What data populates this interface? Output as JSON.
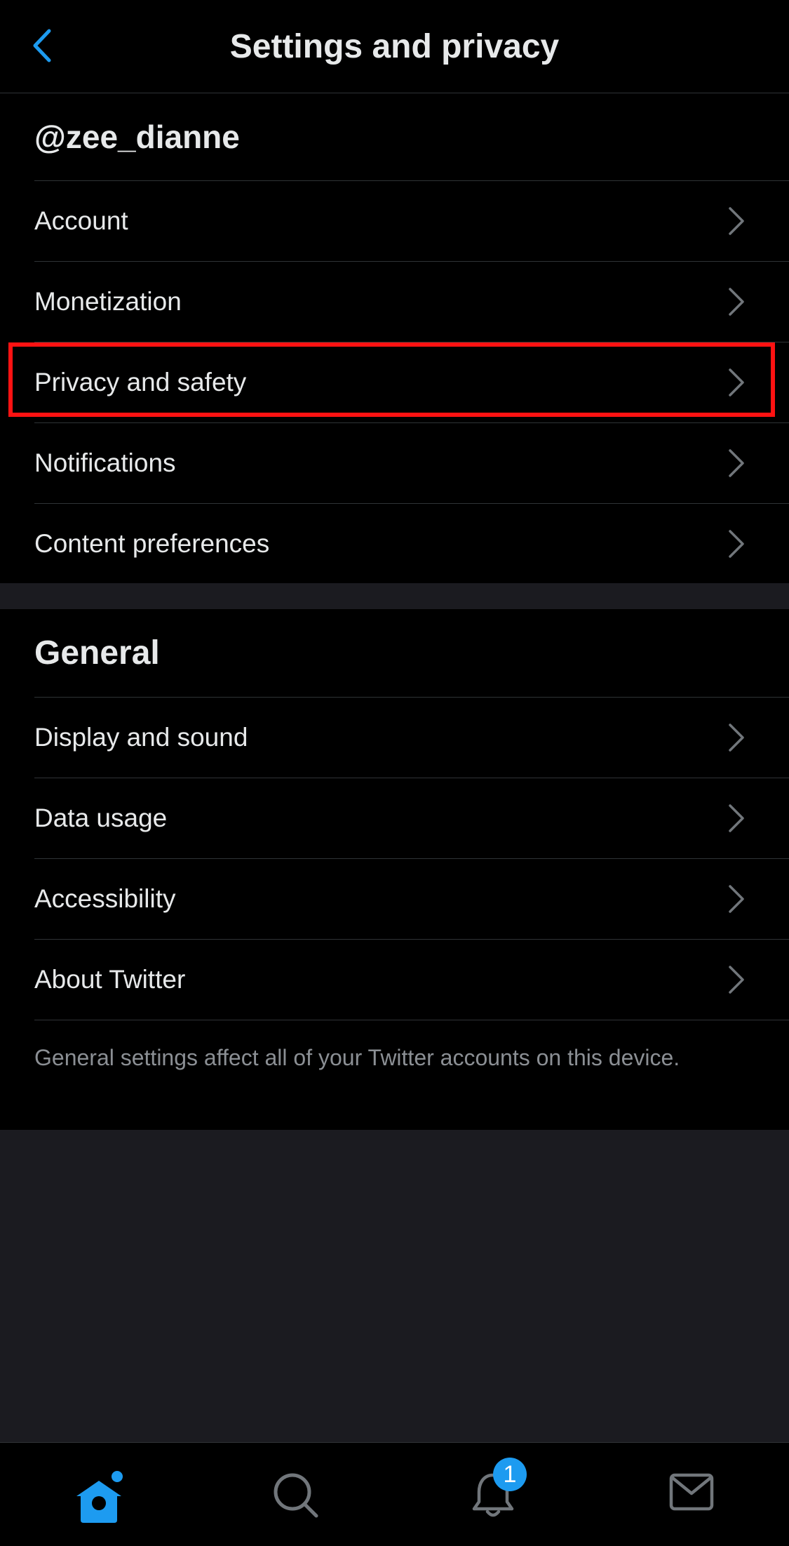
{
  "header": {
    "title": "Settings and privacy",
    "back_icon": "chevron-left-icon"
  },
  "account_section": {
    "username": "@zee_dianne",
    "items": [
      {
        "label": "Account"
      },
      {
        "label": "Monetization"
      },
      {
        "label": "Privacy and safety",
        "highlighted": true
      },
      {
        "label": "Notifications"
      },
      {
        "label": "Content preferences"
      }
    ]
  },
  "general_section": {
    "title": "General",
    "items": [
      {
        "label": "Display and sound"
      },
      {
        "label": "Data usage"
      },
      {
        "label": "Accessibility"
      },
      {
        "label": "About Twitter"
      }
    ],
    "footnote": "General settings affect all of your Twitter accounts on this device."
  },
  "tabbar": {
    "tabs": [
      {
        "icon": "home-icon",
        "active": true,
        "has_dot": true
      },
      {
        "icon": "search-icon"
      },
      {
        "icon": "bell-icon",
        "badge": "1"
      },
      {
        "icon": "mail-icon"
      }
    ]
  },
  "colors": {
    "accent": "#1d9bf0",
    "highlight": "#ff1212",
    "background": "#000000",
    "separator_bg": "#1b1b20"
  }
}
